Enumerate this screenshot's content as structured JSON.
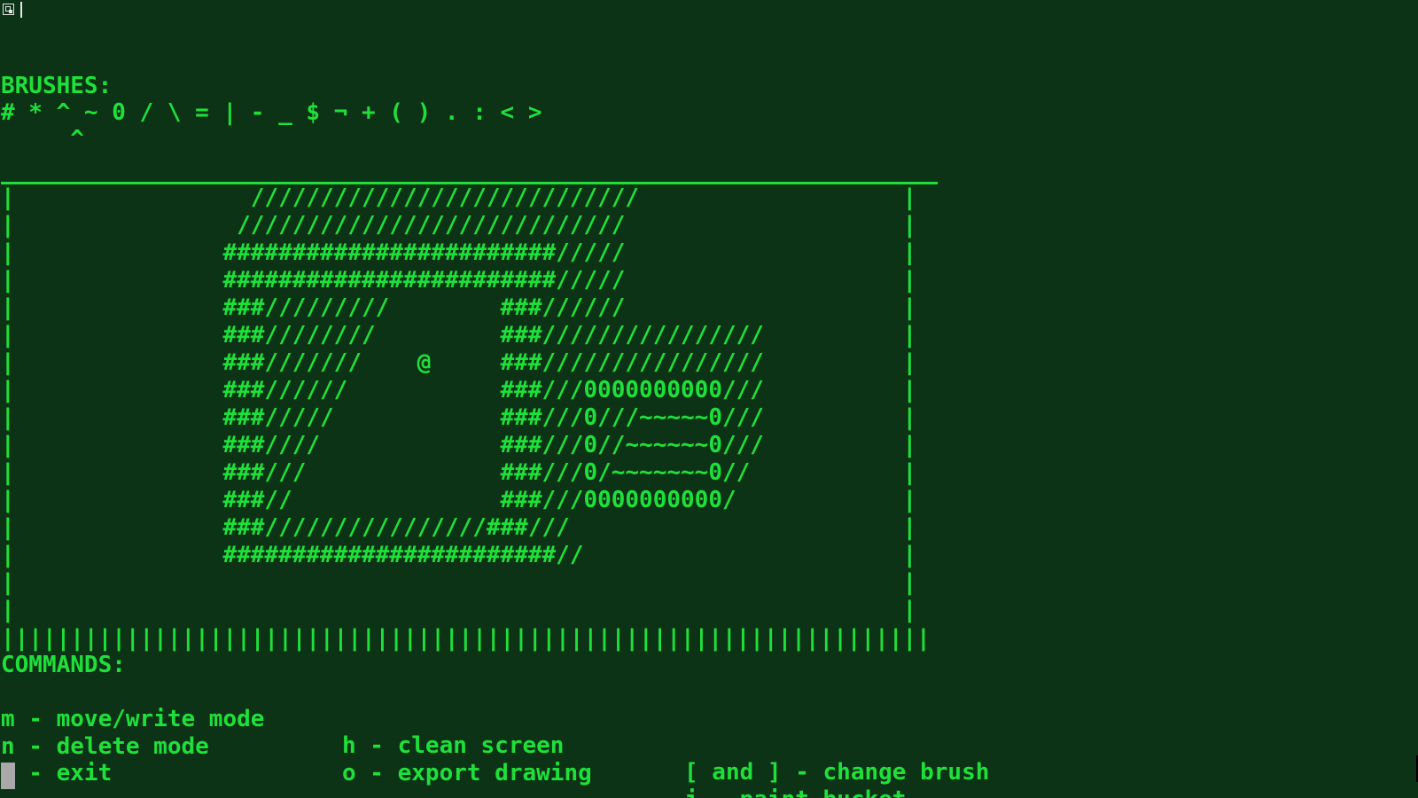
{
  "window": {
    "icon": "app-window-icon"
  },
  "brushes": {
    "title": "BRUSHES:",
    "list": "# * ^ ~ 0 / \\ = | - _ $ ¬ + ( ) . : < >",
    "selector": "     ^"
  },
  "canvas": {
    "rows": [
      "|                 ////////////////////////////                   |",
      "|                ////////////////////////////                    |",
      "|               ########################/////                    |",
      "|               ########################/////                    |",
      "|               ###/////////        ###//////                    |",
      "|               ###////////         ###////////////////          |",
      "|               ###///////    @     ###////////////////          |",
      "|               ###//////           ###///0000000000///          |",
      "|               ###/////            ###///0///~~~~~0///          |",
      "|               ###////             ###///0//~~~~~~0///          |",
      "|               ###///              ###///0/~~~~~~~0//           |",
      "|               ###//               ###///0000000000/            |",
      "|               ###////////////////###///                        |",
      "|               ########################//                       |",
      "|                                                                |",
      "|                                                                |"
    ],
    "bottom_border": "|||||||||||||||||||||||||||||||||||||||||||||||||||||||||||||||||||"
  },
  "commands": {
    "title": "COMMANDS:",
    "move_write": "m - move/write mode",
    "clean_screen": "h - clean screen",
    "change_brush": "[ and ] - change brush",
    "delete_mode": "n - delete mode",
    "export_drawing": "o - export drawing",
    "paint_bucket": "j - paint bucket",
    "exit": "q - exit"
  }
}
